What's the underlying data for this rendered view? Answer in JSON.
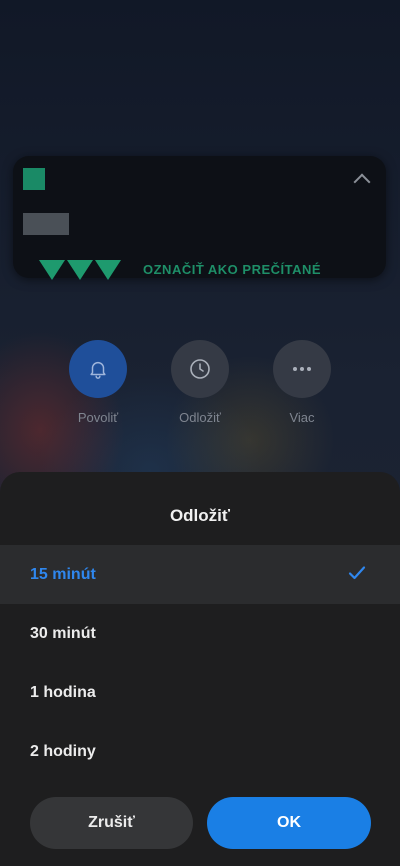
{
  "notification": {
    "text_fragment": "OZNAČIŤ AKO PREČÍTANÉ"
  },
  "actions": [
    {
      "label": "Povoliť",
      "icon": "bell-icon"
    },
    {
      "label": "Odložiť",
      "icon": "clock-icon"
    },
    {
      "label": "Viac",
      "icon": "more-dots-icon"
    }
  ],
  "sheet": {
    "title": "Odložiť",
    "options": [
      {
        "label": "15 minút",
        "selected": true
      },
      {
        "label": "30 minút",
        "selected": false
      },
      {
        "label": "1 hodina",
        "selected": false
      },
      {
        "label": "2 hodiny",
        "selected": false
      }
    ],
    "cancel_label": "Zrušiť",
    "ok_label": "OK"
  },
  "colors": {
    "accent": "#1a7fe5",
    "selected_text": "#2f87ee",
    "sheet_bg": "#1e1e1f"
  }
}
